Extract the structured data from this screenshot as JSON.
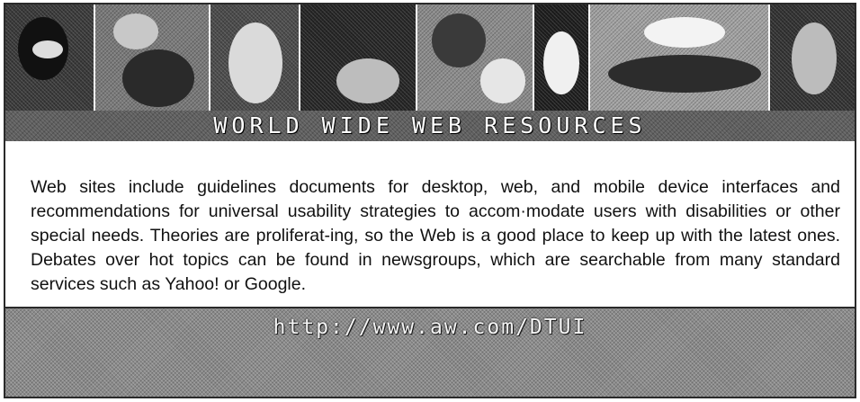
{
  "banner": {
    "title": "WORLD WIDE WEB RESOURCES"
  },
  "body": {
    "paragraph": "Web sites include guidelines documents for desktop, web, and mobile device interfaces and recommendations for universal usability strategies to accom·modate users with disabilities or other special needs. Theories are proliferat-ing, so the Web is a good place to keep up with the latest ones. Debates over hot topics can be found in newsgroups, which are searchable from many standard services such as Yahoo! or Google."
  },
  "footer": {
    "url": "http://www.aw.com/DTUI"
  }
}
